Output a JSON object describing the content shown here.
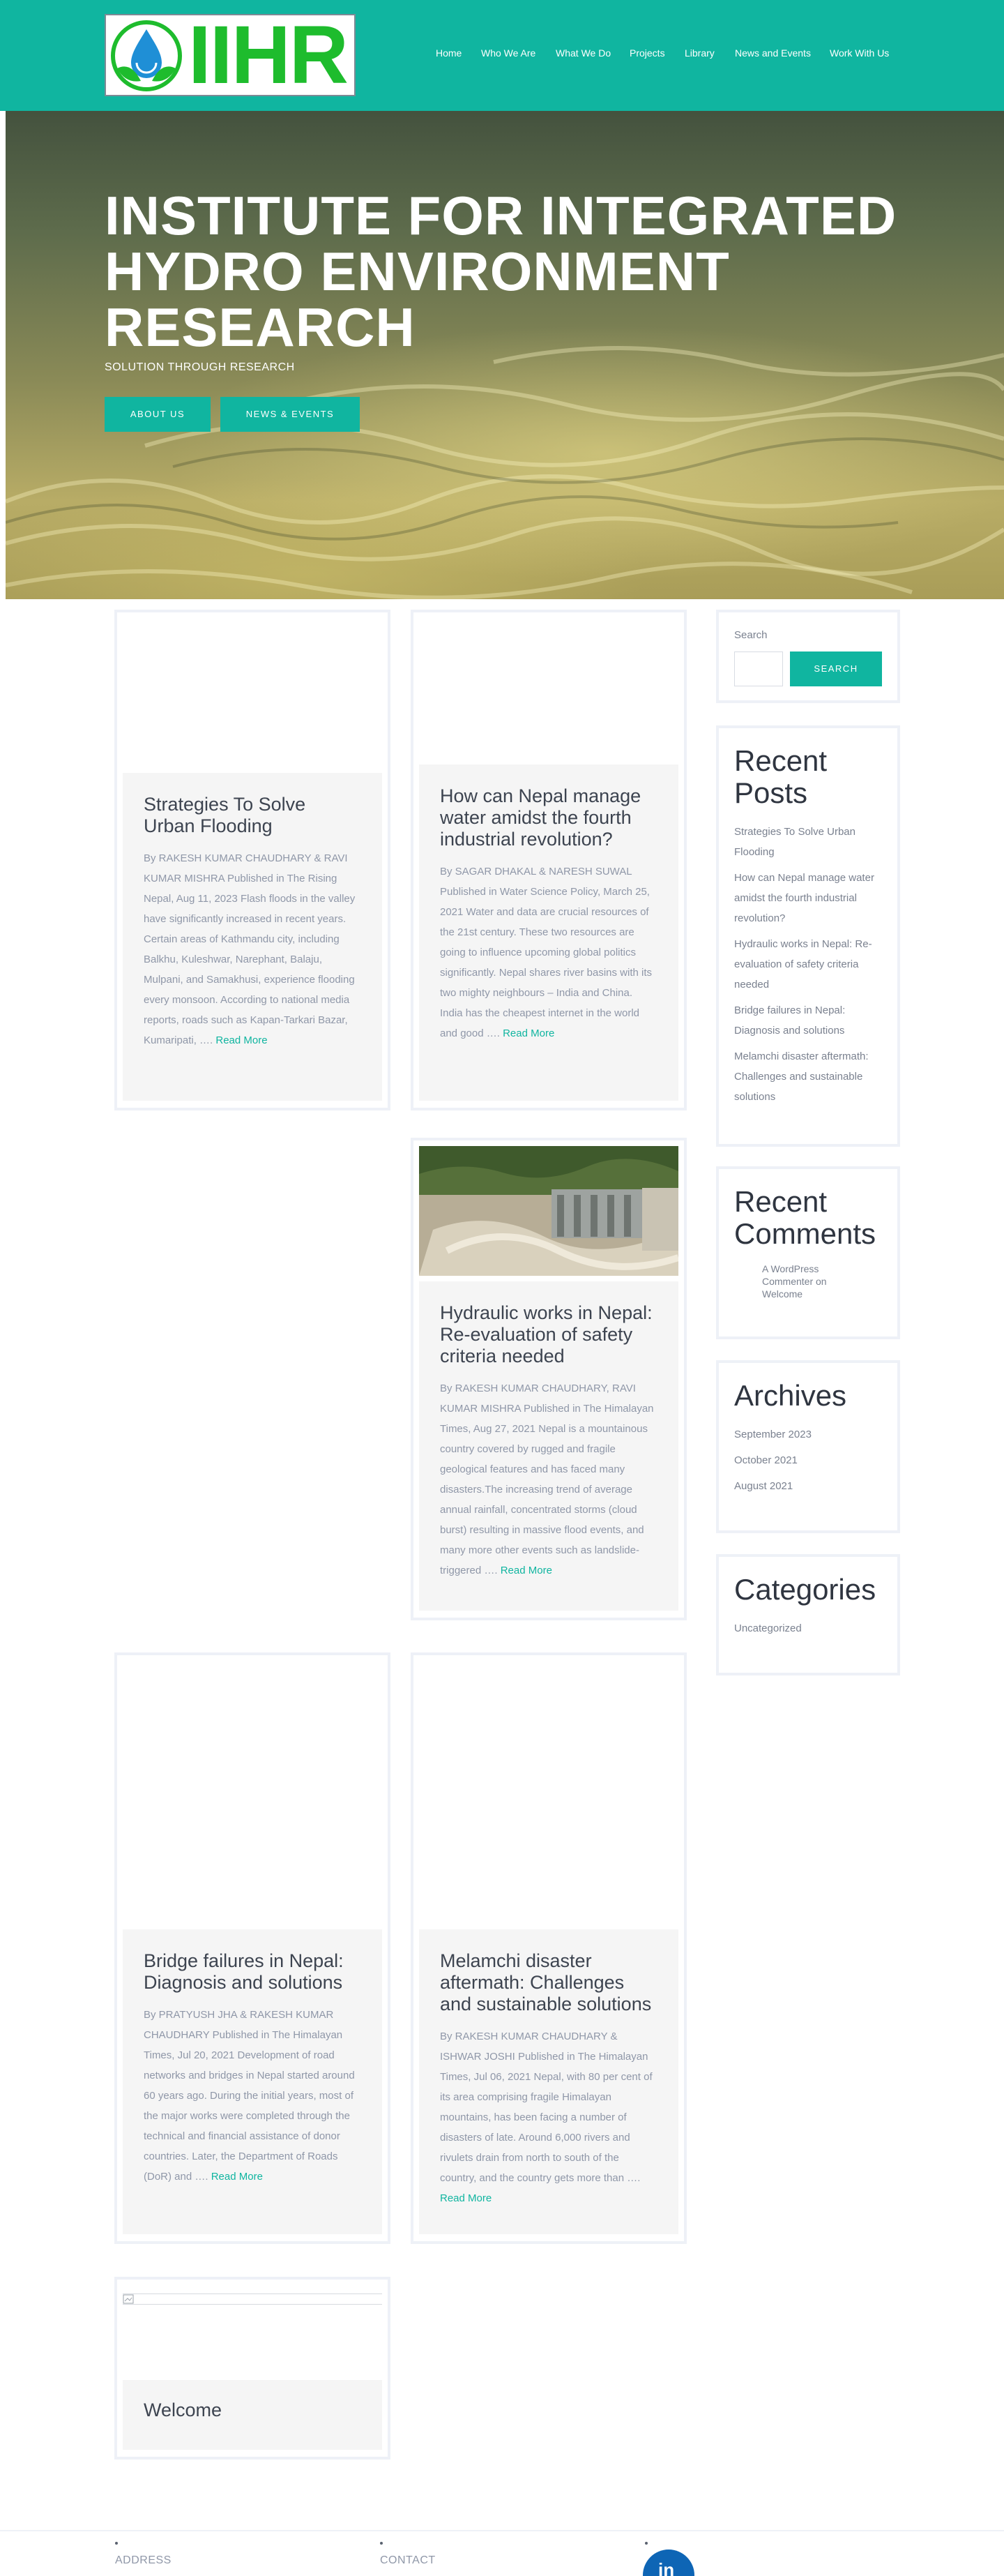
{
  "brand": {
    "logo_text": "IIHR",
    "accent_color": "#10b5a0",
    "logo_color": "#1ebc2d"
  },
  "nav": {
    "items": [
      "Home",
      "Who We Are",
      "What We Do",
      "Projects",
      "Library",
      "News and Events",
      "Work With Us"
    ]
  },
  "hero": {
    "title": "INSTITUTE FOR INTEGRATED HYDRO ENVIRONMENT RESEARCH",
    "subtitle": "SOLUTION THROUGH RESEARCH",
    "buttons": [
      "ABOUT US",
      "NEWS & EVENTS"
    ]
  },
  "posts": [
    {
      "title": "Strategies To Solve Urban Flooding",
      "excerpt": "By RAKESH KUMAR CHAUDHARY & RAVI KUMAR MISHRA Published in The Rising Nepal, Aug 11, 2023 Flash floods in the valley have significantly increased in recent years. Certain areas of Kathmandu city, including Balkhu, Kuleshwar, Narephant, Balaju, Mulpani, and Samakhusi, experience flooding every monsoon. According to national media reports, roads such as Kapan-Tarkari Bazar, Kumaripati, ….",
      "read_more": "Read More"
    },
    {
      "title": "How can Nepal manage water amidst the fourth industrial revolution?",
      "excerpt": "By SAGAR DHAKAL & NARESH SUWAL Published in Water Science Policy, March 25, 2021 Water and data are crucial resources of the 21st century. These two resources are going to influence upcoming global politics significantly. Nepal shares river basins with its two mighty neighbours – India and China. India has the cheapest internet in the world and good ….",
      "read_more": "Read More"
    },
    {
      "title": "Hydraulic works in Nepal: Re-evaluation of safety criteria needed",
      "excerpt": "By RAKESH KUMAR CHAUDHARY, RAVI KUMAR MISHRA Published in The Himalayan Times, Aug 27, 2021 Nepal is a mountainous country covered by rugged and fragile geological features and has faced many disasters.The increasing trend of average annual rainfall, concentrated storms (cloud burst) resulting in massive flood events, and many more other events such as landslide-triggered ….",
      "read_more": "Read More"
    },
    {
      "title": "Bridge failures in Nepal: Diagnosis and solutions",
      "excerpt": "By PRATYUSH JHA & RAKESH KUMAR CHAUDHARY Published in The Himalayan Times, Jul 20, 2021 Development of road networks and bridges in Nepal started around 60 years ago. During the initial years, most of the major works were completed through the technical and financial assistance of donor countries. Later, the Department of Roads (DoR) and ….",
      "read_more": "Read More"
    },
    {
      "title": "Melamchi disaster aftermath: Challenges and sustainable solutions",
      "excerpt": "By RAKESH KUMAR CHAUDHARY & ISHWAR JOSHI Published in The Himalayan Times, Jul 06, 2021 Nepal, with 80 per cent of its area comprising fragile Himalayan mountains, has been facing a number of disasters of late. Around 6,000 rivers and rivulets drain from north to south of the country, and the country gets more than ….",
      "read_more": "Read More"
    },
    {
      "title": "Welcome"
    }
  ],
  "sidebar": {
    "search": {
      "label": "Search",
      "button": "SEARCH"
    },
    "recent_posts": {
      "heading": "Recent Posts",
      "items": [
        "Strategies To Solve Urban Flooding",
        "How can Nepal manage water amidst the fourth industrial revolution?",
        "Hydraulic works in Nepal: Re-evaluation of safety criteria needed",
        "Bridge failures in Nepal: Diagnosis and solutions",
        "Melamchi disaster aftermath: Challenges and sustainable solutions"
      ]
    },
    "recent_comments": {
      "heading": "Recent Comments",
      "items": [
        "A WordPress Commenter on Welcome"
      ]
    },
    "archives": {
      "heading": "Archives",
      "items": [
        "September 2023",
        "October 2021",
        "August 2021"
      ]
    },
    "categories": {
      "heading": "Categories",
      "items": [
        "Uncategorized"
      ]
    }
  },
  "footer": {
    "labels": [
      "ADDRESS",
      "CONTACT"
    ],
    "social_icon": "linkedin-icon"
  }
}
